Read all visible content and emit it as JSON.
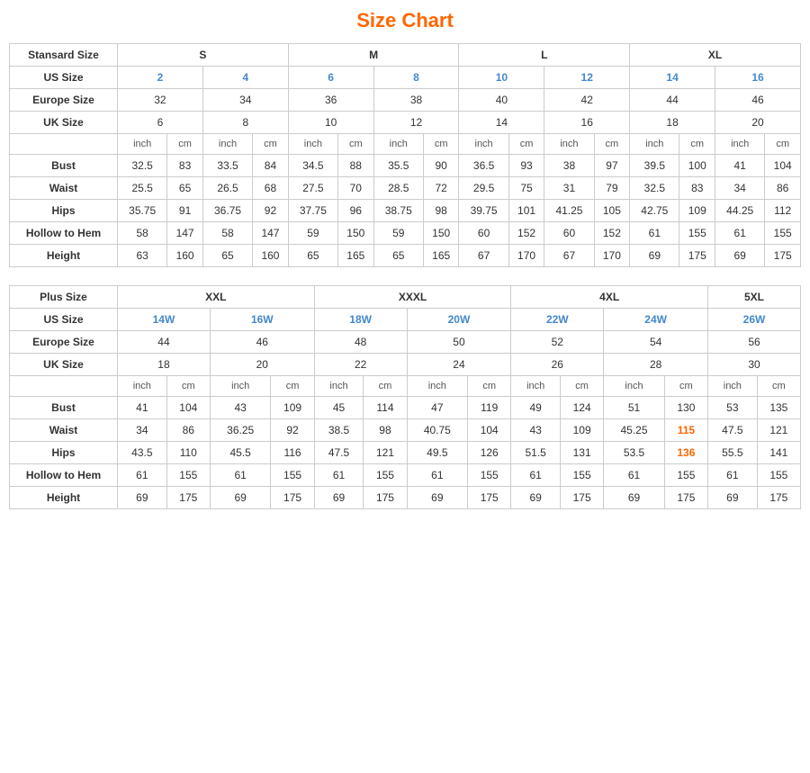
{
  "title": "Size Chart",
  "standard": {
    "sectionLabel": "Stansard Size",
    "sizeGroups": [
      "S",
      "M",
      "L",
      "XL"
    ],
    "usSizes": [
      "2",
      "4",
      "6",
      "8",
      "10",
      "12",
      "14",
      "16"
    ],
    "europeSizes": [
      "32",
      "34",
      "36",
      "38",
      "40",
      "42",
      "44",
      "46"
    ],
    "ukSizes": [
      "6",
      "8",
      "10",
      "12",
      "14",
      "16",
      "18",
      "20"
    ],
    "unitHeaders": [
      "inch",
      "cm",
      "inch",
      "cm",
      "inch",
      "cm",
      "inch",
      "cm",
      "inch",
      "cm",
      "inch",
      "cm",
      "inch",
      "cm",
      "inch",
      "cm"
    ],
    "measurements": [
      {
        "label": "Bust",
        "values": [
          "32.5",
          "83",
          "33.5",
          "84",
          "34.5",
          "88",
          "35.5",
          "90",
          "36.5",
          "93",
          "38",
          "97",
          "39.5",
          "100",
          "41",
          "104"
        ]
      },
      {
        "label": "Waist",
        "values": [
          "25.5",
          "65",
          "26.5",
          "68",
          "27.5",
          "70",
          "28.5",
          "72",
          "29.5",
          "75",
          "31",
          "79",
          "32.5",
          "83",
          "34",
          "86"
        ]
      },
      {
        "label": "Hips",
        "values": [
          "35.75",
          "91",
          "36.75",
          "92",
          "37.75",
          "96",
          "38.75",
          "98",
          "39.75",
          "101",
          "41.25",
          "105",
          "42.75",
          "109",
          "44.25",
          "112"
        ]
      },
      {
        "label": "Hollow to Hem",
        "values": [
          "58",
          "147",
          "58",
          "147",
          "59",
          "150",
          "59",
          "150",
          "60",
          "152",
          "60",
          "152",
          "61",
          "155",
          "61",
          "155"
        ]
      },
      {
        "label": "Height",
        "values": [
          "63",
          "160",
          "65",
          "160",
          "65",
          "165",
          "65",
          "165",
          "67",
          "170",
          "67",
          "170",
          "69",
          "175",
          "69",
          "175"
        ]
      }
    ]
  },
  "plus": {
    "sectionLabel": "Plus Size",
    "sizeGroups": [
      "XXL",
      "XXXL",
      "4XL",
      "5XL"
    ],
    "usSizes": [
      "14W",
      "16W",
      "18W",
      "20W",
      "22W",
      "24W",
      "26W"
    ],
    "europeSizes": [
      "44",
      "46",
      "48",
      "50",
      "52",
      "54",
      "56"
    ],
    "ukSizes": [
      "18",
      "20",
      "22",
      "24",
      "26",
      "28",
      "30"
    ],
    "unitHeaders": [
      "inch",
      "cm",
      "inch",
      "cm",
      "inch",
      "cm",
      "inch",
      "cm",
      "inch",
      "cm",
      "inch",
      "cm",
      "inch",
      "cm"
    ],
    "measurements": [
      {
        "label": "Bust",
        "values": [
          "41",
          "104",
          "43",
          "109",
          "45",
          "114",
          "47",
          "119",
          "49",
          "124",
          "51",
          "130",
          "53",
          "135"
        ]
      },
      {
        "label": "Waist",
        "values": [
          "34",
          "86",
          "36.25",
          "92",
          "38.5",
          "98",
          "40.75",
          "104",
          "43",
          "109",
          "45.25",
          "115",
          "47.5",
          "121"
        ]
      },
      {
        "label": "Hips",
        "values": [
          "43.5",
          "110",
          "45.5",
          "116",
          "47.5",
          "121",
          "49.5",
          "126",
          "51.5",
          "131",
          "53.5",
          "136",
          "55.5",
          "141"
        ]
      },
      {
        "label": "Hollow to Hem",
        "values": [
          "61",
          "155",
          "61",
          "155",
          "61",
          "155",
          "61",
          "155",
          "61",
          "155",
          "61",
          "155",
          "61",
          "155"
        ]
      },
      {
        "label": "Height",
        "values": [
          "69",
          "175",
          "69",
          "175",
          "69",
          "175",
          "69",
          "175",
          "69",
          "175",
          "69",
          "175",
          "69",
          "175"
        ]
      }
    ]
  }
}
